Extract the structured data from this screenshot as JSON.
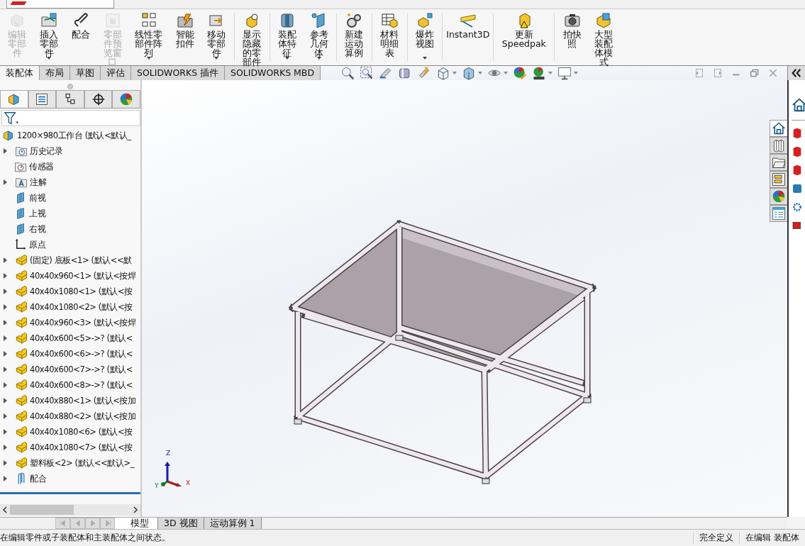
{
  "ribbon": {
    "groups": [
      {
        "buttons": [
          {
            "label": "编辑零部件",
            "disabled": true,
            "dropdown": false
          },
          {
            "label": "插入零部件",
            "disabled": false,
            "dropdown": true
          },
          {
            "label": "配合",
            "disabled": false,
            "dropdown": false
          },
          {
            "label": "零部件预览窗口",
            "disabled": true,
            "dropdown": false
          },
          {
            "label": "线性零部件阵列",
            "disabled": false,
            "dropdown": true
          },
          {
            "label": "智能扣件",
            "disabled": false,
            "dropdown": false
          },
          {
            "label": "移动零部件",
            "disabled": false,
            "dropdown": true
          }
        ]
      },
      {
        "buttons": [
          {
            "label": "显示隐藏的零部件",
            "disabled": false,
            "dropdown": false
          }
        ]
      },
      {
        "buttons": [
          {
            "label": "装配体特征",
            "disabled": false,
            "dropdown": true
          },
          {
            "label": "参考几何体",
            "disabled": false,
            "dropdown": true
          }
        ]
      },
      {
        "buttons": [
          {
            "label": "新建运动算例",
            "disabled": false,
            "dropdown": false
          }
        ]
      },
      {
        "buttons": [
          {
            "label": "材料明细表",
            "disabled": false,
            "dropdown": false
          }
        ]
      },
      {
        "buttons": [
          {
            "label": "爆炸视图",
            "disabled": false,
            "dropdown": true
          }
        ]
      },
      {
        "buttons": [
          {
            "label": "Instant3D",
            "disabled": false,
            "dropdown": false
          }
        ]
      },
      {
        "buttons": [
          {
            "label": "更新 Speedpak",
            "disabled": false,
            "dropdown": false
          }
        ]
      },
      {
        "buttons": [
          {
            "label": "拍快照",
            "disabled": false,
            "dropdown": false
          },
          {
            "label": "大型装配体模式",
            "disabled": false,
            "dropdown": false
          }
        ]
      }
    ]
  },
  "command_tabs": [
    {
      "label": "装配体",
      "selected": true
    },
    {
      "label": "布局",
      "selected": false
    },
    {
      "label": "草图",
      "selected": false
    },
    {
      "label": "评估",
      "selected": false
    },
    {
      "label": "SOLIDWORKS 插件",
      "selected": false
    },
    {
      "label": "SOLIDWORKS MBD",
      "selected": false
    }
  ],
  "feature_manager": {
    "panel_tabs": [
      {
        "selected": true
      },
      {
        "selected": false
      },
      {
        "selected": false
      },
      {
        "selected": false
      },
      {
        "selected": false
      }
    ],
    "tree": {
      "label": "1200×980工作台  (默认<默认_",
      "kind": "assembly",
      "children": [
        {
          "label": "历史记录",
          "kind": "history",
          "expandable": true
        },
        {
          "label": "传感器",
          "kind": "sensor",
          "expandable": false
        },
        {
          "label": "注解",
          "kind": "annotation",
          "expandable": true
        },
        {
          "label": "前视",
          "kind": "plane",
          "expandable": false
        },
        {
          "label": "上视",
          "kind": "plane",
          "expandable": false
        },
        {
          "label": "右视",
          "kind": "plane",
          "expandable": false
        },
        {
          "label": "原点",
          "kind": "origin",
          "expandable": false
        },
        {
          "label": "(固定) 底板<1> (默认<<默",
          "kind": "part",
          "expandable": true
        },
        {
          "label": "40x40x960<1> (默认<按焊",
          "kind": "part",
          "expandable": true
        },
        {
          "label": "40x40x1080<1> (默认<按",
          "kind": "part",
          "expandable": true
        },
        {
          "label": "40x40x1080<2> (默认<按",
          "kind": "part",
          "expandable": true
        },
        {
          "label": "40x40x960<3> (默认<按焊",
          "kind": "part",
          "expandable": true
        },
        {
          "label": "40x40x600<5>->? (默认<",
          "kind": "part",
          "expandable": true
        },
        {
          "label": "40x40x600<6>->? (默认<",
          "kind": "part",
          "expandable": true
        },
        {
          "label": "40x40x600<7>->? (默认<",
          "kind": "part",
          "expandable": true
        },
        {
          "label": "40x40x600<8>->? (默认<",
          "kind": "part",
          "expandable": true
        },
        {
          "label": "40x40x880<1> (默认<按加",
          "kind": "part",
          "expandable": true
        },
        {
          "label": "40x40x880<2> (默认<按加",
          "kind": "part",
          "expandable": true
        },
        {
          "label": "40x40x1080<6> (默认<按",
          "kind": "part",
          "expandable": true
        },
        {
          "label": "40x40x1080<7> (默认<按",
          "kind": "part",
          "expandable": true
        },
        {
          "label": "塑料板<2> (默认<<默认>_",
          "kind": "part",
          "expandable": true
        },
        {
          "label": "配合",
          "kind": "mates",
          "expandable": true
        }
      ]
    }
  },
  "graphics": {
    "triad": {
      "x": "X",
      "y": "Y",
      "z": "Z"
    }
  },
  "bottom_tabs": [
    {
      "label": "模型",
      "selected": true
    },
    {
      "label": "3D 视图",
      "selected": false
    },
    {
      "label": "运动算例 1",
      "selected": false
    }
  ],
  "task_pane": {
    "tabs": [
      {
        "selected": true
      },
      {
        "selected": false
      },
      {
        "selected": false
      },
      {
        "selected": false
      },
      {
        "selected": false
      },
      {
        "selected": false
      }
    ]
  },
  "status_bar": {
    "message": "在编辑零件或子装配体和主装配体之间状态。",
    "items": [
      "完全定义",
      "在编辑 装配体"
    ]
  }
}
